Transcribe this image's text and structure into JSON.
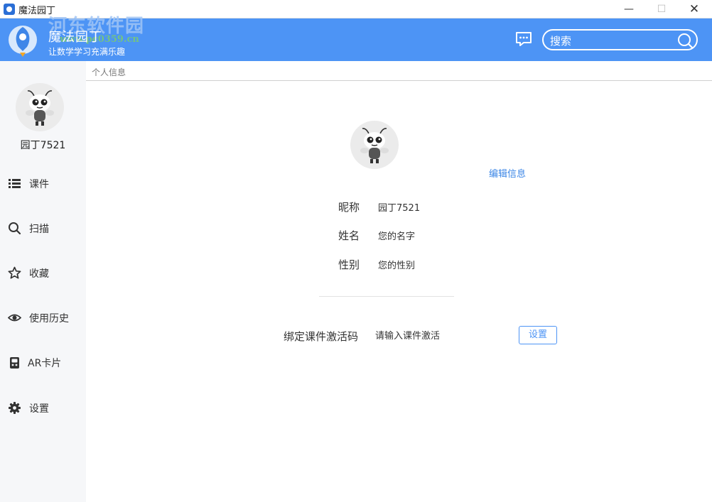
{
  "window": {
    "title": "魔法园丁",
    "minimize": "—",
    "maximize": "☐",
    "close": "✕"
  },
  "header": {
    "app_name": "魔法园丁",
    "slogan": "让数学学习充满乐趣",
    "watermark": "河东软件园",
    "watermark_url": "www.pc0359.cn",
    "search_placeholder": "搜索",
    "accent_color": "#4d94f5"
  },
  "sidebar": {
    "username": "园丁7521",
    "items": [
      {
        "label": "课件",
        "icon": "list-icon"
      },
      {
        "label": "扫描",
        "icon": "search-icon"
      },
      {
        "label": "收藏",
        "icon": "star-icon"
      },
      {
        "label": "使用历史",
        "icon": "eye-icon"
      },
      {
        "label": "AR卡片",
        "icon": "ar-card-icon"
      },
      {
        "label": "设置",
        "icon": "gear-icon"
      }
    ]
  },
  "main": {
    "breadcrumb": "个人信息",
    "edit_link": "编辑信息",
    "fields": [
      {
        "label": "昵称",
        "value": "园丁7521"
      },
      {
        "label": "姓名",
        "value": "您的名字"
      },
      {
        "label": "性别",
        "value": "您的性别"
      }
    ],
    "bind": {
      "label": "绑定课件激活码",
      "placeholder": "请输入课件激活",
      "button": "设置"
    }
  }
}
